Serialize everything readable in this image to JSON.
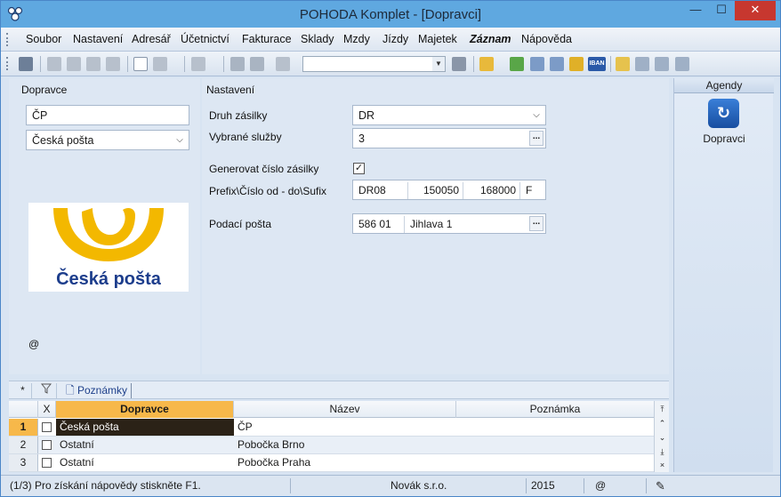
{
  "window": {
    "title": "POHODA Komplet - [Dopravci]",
    "min_glyph": "—",
    "max_glyph": "☐",
    "close_glyph": "✕"
  },
  "menu": {
    "items": [
      "Soubor",
      "Nastavení",
      "Adresář",
      "Účetnictví",
      "Fakturace",
      "Sklady",
      "Mzdy",
      "Jízdy",
      "Majetek",
      "Záznam",
      "Nápověda"
    ]
  },
  "toolbar": {
    "combo_value": "",
    "iban_label": "IBAN"
  },
  "left": {
    "section_label": "Dopravce",
    "code_value": "ČP",
    "name_value": "Česká pošta",
    "logo_text": "Česká pošta",
    "at_symbol": "@"
  },
  "settings": {
    "section_label": "Nastavení",
    "shipment_type_label": "Druh zásilky",
    "shipment_type_value": "DR",
    "services_label": "Vybrané služby",
    "services_value": "3",
    "generate_label": "Generovat číslo zásilky",
    "generate_checked": "✓",
    "prefix_label": "Prefix\\Číslo od - do\\Sufix",
    "prefix_value": "DR08",
    "number_from": "150050",
    "number_to": "168000",
    "suffix_value": "F",
    "post_office_label": "Podací pošta",
    "post_office_code": "586 01",
    "post_office_name": "Jihlava 1",
    "dots": "..."
  },
  "agenda": {
    "header": "Agendy",
    "item_label": "Dopravci",
    "item_glyph": "↻"
  },
  "tabs": {
    "star": "*",
    "notes_label": "Poznámky"
  },
  "grid": {
    "headers": {
      "x": "X",
      "carrier": "Dopravce",
      "name": "Název",
      "note": "Poznámka"
    },
    "rows": [
      {
        "num": "1",
        "carrier": "Česká pošta",
        "name": "ČP",
        "note": ""
      },
      {
        "num": "2",
        "carrier": "Ostatní",
        "name": "Pobočka Brno",
        "note": ""
      },
      {
        "num": "3",
        "carrier": "Ostatní",
        "name": "Pobočka Praha",
        "note": ""
      }
    ]
  },
  "status": {
    "record_info": "(1/3) Pro získání nápovědy stiskněte F1.",
    "company": "Novák s.r.o.",
    "year": "2015",
    "at": "@"
  },
  "colors": {
    "titlebar": "#5fa8e0",
    "active_header": "#f7b84a",
    "logo_yellow": "#f3b800",
    "logo_blue": "#1c3d8c"
  }
}
